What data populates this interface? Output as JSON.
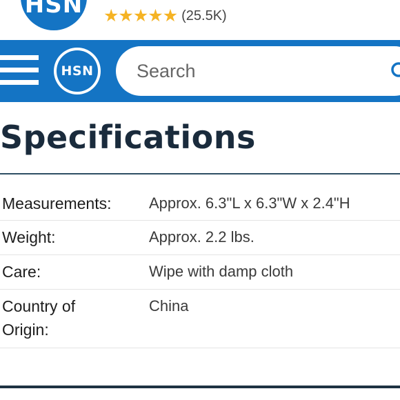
{
  "app_banner": {
    "logo_text": "HSN",
    "rating_icon": "star-icon",
    "rating_stars": 5,
    "rating_count": "(25.5K)"
  },
  "header": {
    "logo_text": "HSN",
    "menu_icon": "hamburger-menu-icon",
    "search_placeholder": "Search",
    "search_icon": "search-icon"
  },
  "specifications": {
    "title": "Specifications",
    "rows": [
      {
        "label": "Measurements:",
        "value": "Approx. 6.3\"L x 6.3\"W x 2.4\"H"
      },
      {
        "label": "Weight:",
        "value": "Approx. 2.2 lbs."
      },
      {
        "label": "Care:",
        "value": "Wipe with damp cloth"
      },
      {
        "label": "Country of Origin:",
        "value": "China"
      }
    ]
  },
  "colors": {
    "brand_blue": "#1474c4",
    "star_gold": "#f5b324",
    "title_navy": "#1a2b3c"
  }
}
